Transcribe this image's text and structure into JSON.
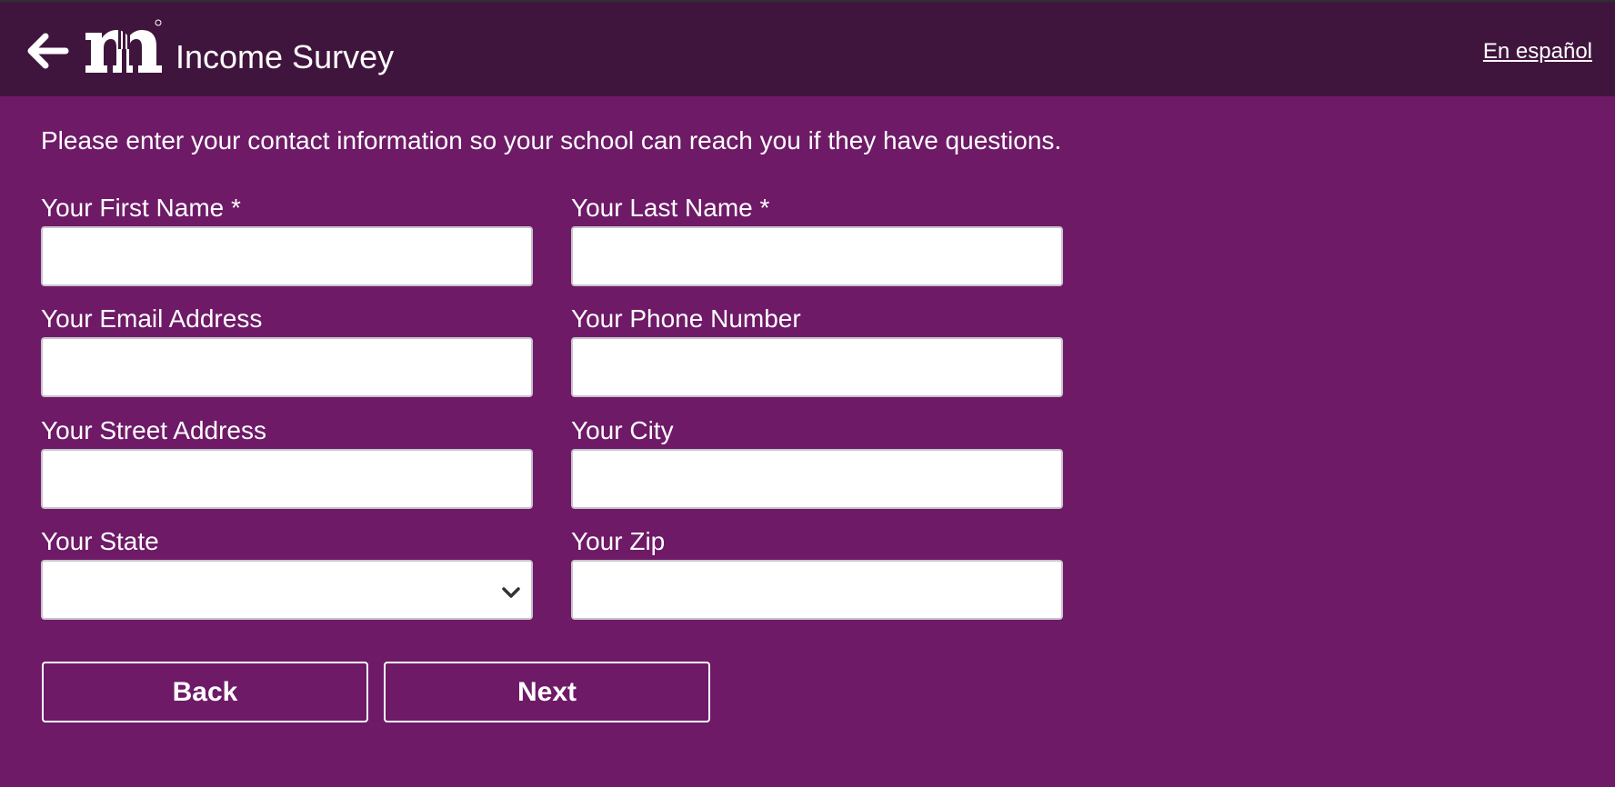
{
  "header": {
    "title": "Income Survey",
    "language_link": "En español",
    "back_icon": "arrow-left-icon",
    "logo_icon": "m-fork-logo"
  },
  "form": {
    "intro": "Please enter your contact information so your school can reach you if they have questions.",
    "first_name": {
      "label": "Your First Name *",
      "value": "",
      "placeholder": ""
    },
    "last_name": {
      "label": "Your Last Name *",
      "value": "",
      "placeholder": ""
    },
    "email": {
      "label": "Your Email Address",
      "value": "",
      "placeholder": ""
    },
    "phone": {
      "label": "Your Phone Number",
      "value": "",
      "placeholder": ""
    },
    "street": {
      "label": "Your Street Address",
      "value": "",
      "placeholder": ""
    },
    "city": {
      "label": "Your City",
      "value": "",
      "placeholder": ""
    },
    "state": {
      "label": "Your State",
      "selected": "",
      "icon": "chevron-down-icon"
    },
    "zip": {
      "label": "Your Zip",
      "value": "",
      "placeholder": ""
    }
  },
  "buttons": {
    "back": "Back",
    "next": "Next"
  },
  "colors": {
    "page_background": "#6e1a67",
    "header_background": "#40153d",
    "text": "#ffffff"
  }
}
